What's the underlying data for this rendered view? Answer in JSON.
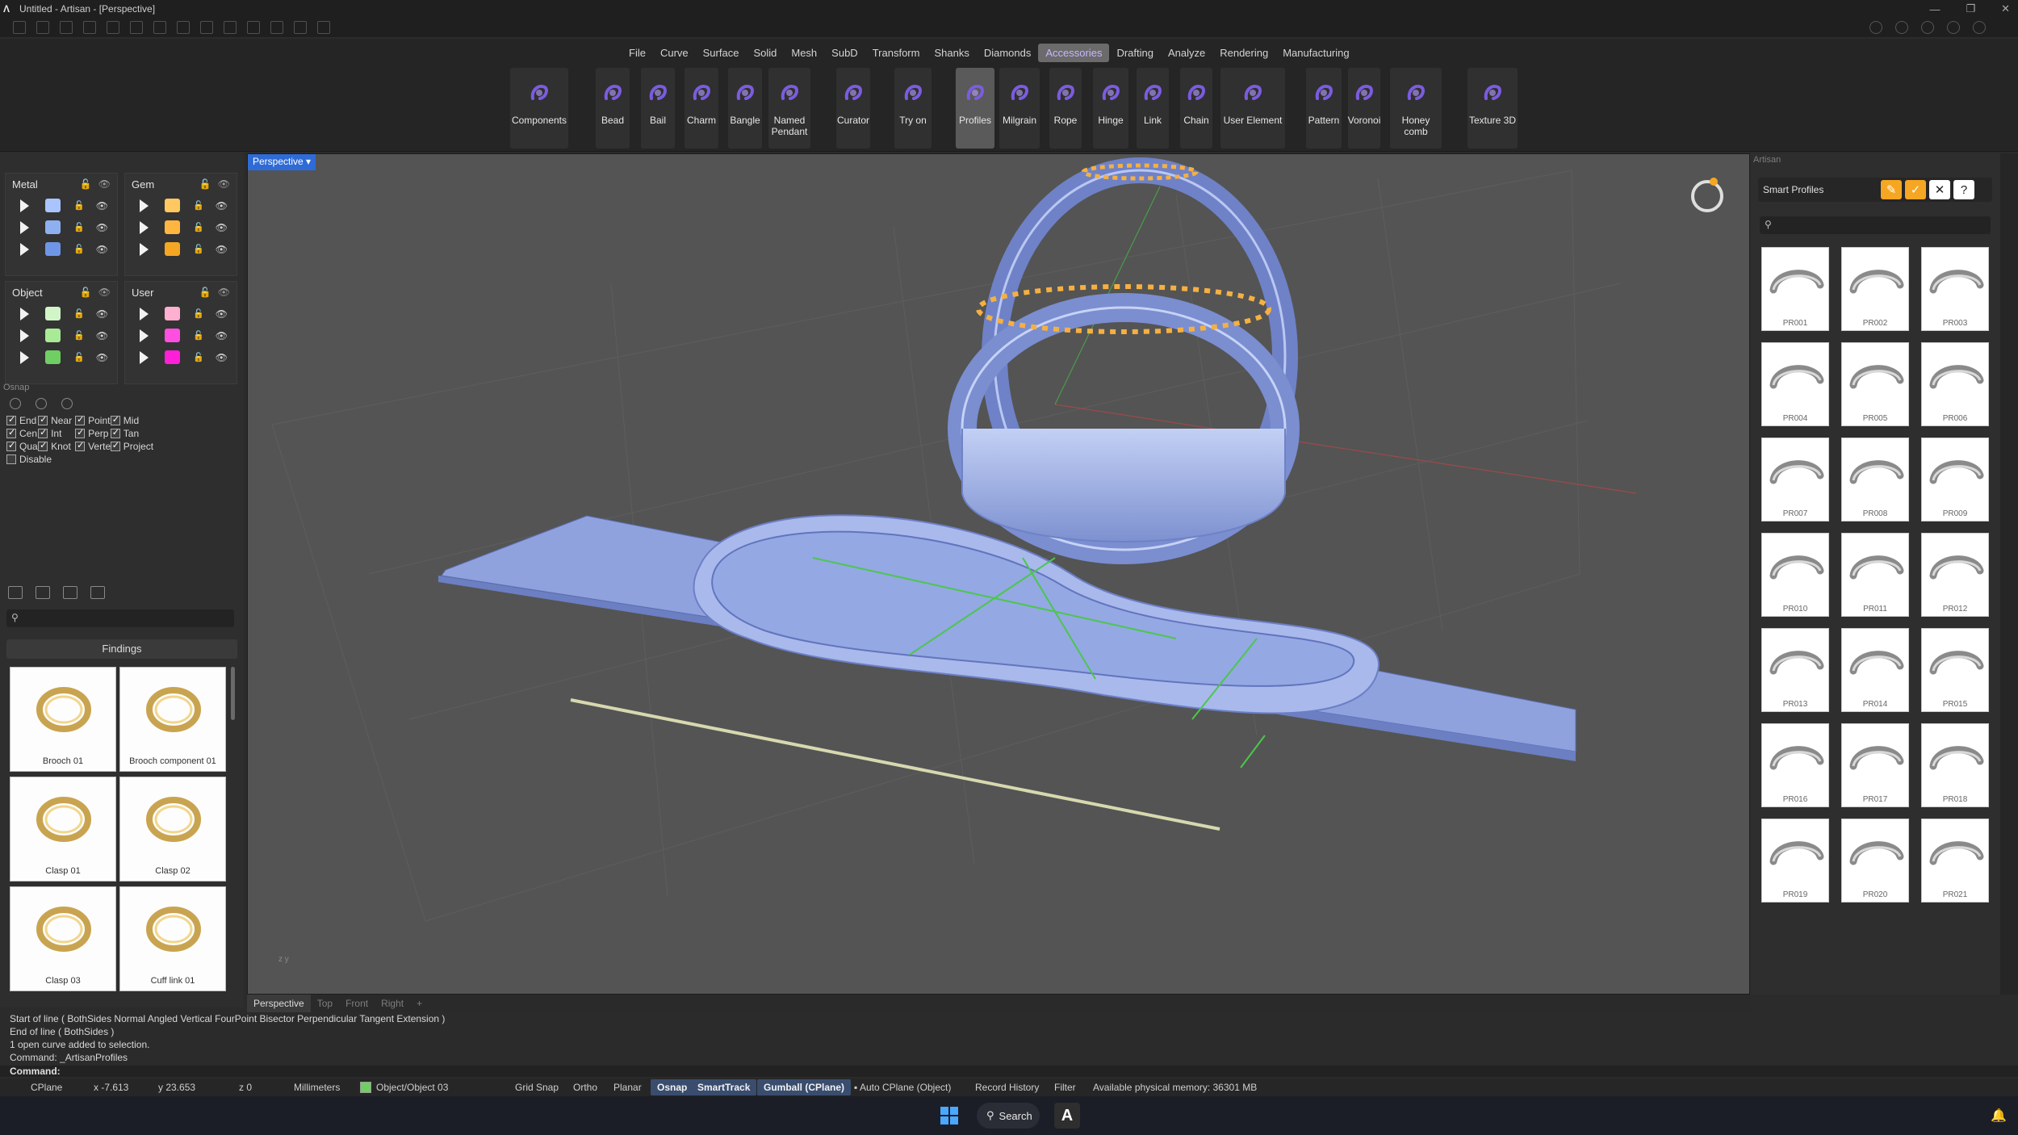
{
  "window": {
    "title": "Untitled - Artisan - [Perspective]",
    "controls": [
      "—",
      "❐",
      "✕"
    ]
  },
  "menu": {
    "items": [
      "File",
      "Curve",
      "Surface",
      "Solid",
      "Mesh",
      "SubD",
      "Transform",
      "Shanks",
      "Diamonds",
      "Accessories",
      "Drafting",
      "Analyze",
      "Rendering",
      "Manufacturing"
    ],
    "active": "Accessories"
  },
  "ribbon": {
    "buttons": [
      {
        "label": "Components",
        "icon": "components-icon"
      },
      {
        "label": "Bead",
        "icon": "bead-icon"
      },
      {
        "label": "Bail",
        "icon": "bail-icon"
      },
      {
        "label": "Charm",
        "icon": "charm-icon"
      },
      {
        "label": "Bangle",
        "icon": "bangle-icon"
      },
      {
        "label": "Named\nPendant",
        "icon": "named-pendant-icon"
      },
      {
        "label": "Curator",
        "icon": "curator-icon"
      },
      {
        "label": "Try on",
        "icon": "try-on-icon"
      },
      {
        "label": "Profiles",
        "icon": "profiles-icon"
      },
      {
        "label": "Milgrain",
        "icon": "milgrain-icon"
      },
      {
        "label": "Rope",
        "icon": "rope-icon"
      },
      {
        "label": "Hinge",
        "icon": "hinge-icon"
      },
      {
        "label": "Link",
        "icon": "link-icon"
      },
      {
        "label": "Chain",
        "icon": "chain-icon"
      },
      {
        "label": "User Element",
        "icon": "user-element-icon"
      },
      {
        "label": "Pattern",
        "icon": "pattern-icon"
      },
      {
        "label": "Voronoi",
        "icon": "voronoi-icon"
      },
      {
        "label": "Honey comb",
        "icon": "honeycomb-icon"
      },
      {
        "label": "Texture 3D",
        "icon": "texture-3d-icon"
      }
    ],
    "active": "Profiles",
    "accent": "#7b5ce0"
  },
  "layers": {
    "groups": [
      {
        "name": "Metal",
        "colors": [
          "#a9c4ff",
          "#8fb0f0",
          "#6f96e6"
        ]
      },
      {
        "name": "Gem",
        "colors": [
          "#ffc860",
          "#ffb640",
          "#f5a623"
        ]
      },
      {
        "name": "Object",
        "colors": [
          "#d2f5c8",
          "#a8ea96",
          "#6fcf62"
        ]
      },
      {
        "name": "User",
        "colors": [
          "#ffb0d0",
          "#ff4fe0",
          "#ff1fd8"
        ]
      }
    ]
  },
  "osnap": {
    "header": "Osnap",
    "items": [
      {
        "label": "End",
        "checked": true
      },
      {
        "label": "Near",
        "checked": true
      },
      {
        "label": "Point",
        "checked": true
      },
      {
        "label": "Mid",
        "checked": true
      },
      {
        "label": "Cen",
        "checked": true
      },
      {
        "label": "Int",
        "checked": true
      },
      {
        "label": "Perp",
        "checked": true
      },
      {
        "label": "Tan",
        "checked": true
      },
      {
        "label": "Quad",
        "checked": true
      },
      {
        "label": "Knot",
        "checked": true
      },
      {
        "label": "Vertex",
        "checked": true
      },
      {
        "label": "Project",
        "checked": true
      },
      {
        "label": "Disable",
        "checked": false
      }
    ]
  },
  "library": {
    "search_placeholder": "",
    "category": "Findings",
    "items": [
      "Brooch 01",
      "Brooch component 01",
      "Clasp 01",
      "Clasp 02",
      "Clasp 03",
      "Cuff link 01"
    ]
  },
  "viewport": {
    "label": "Perspective",
    "tabs": [
      "Perspective",
      "Top",
      "Front",
      "Right",
      "+"
    ],
    "active_tab": "Perspective"
  },
  "smart_profiles": {
    "panel_title": "Artisan",
    "title": "Smart Profiles",
    "items": [
      "PR001",
      "PR002",
      "PR003",
      "PR004",
      "PR005",
      "PR006",
      "PR007",
      "PR008",
      "PR009",
      "PR010",
      "PR011",
      "PR012",
      "PR013",
      "PR014",
      "PR015",
      "PR016",
      "PR017",
      "PR018",
      "PR019",
      "PR020",
      "PR021"
    ]
  },
  "command": {
    "history": [
      "Start of line ( BothSides  Normal  Angled  Vertical  FourPoint  Bisector  Perpendicular  Tangent  Extension )",
      "End of line ( BothSides )",
      "1 open curve added to selection.",
      "Command: _ArtisanProfiles"
    ],
    "prompt": "Command:"
  },
  "status": {
    "cplane": "CPlane",
    "x": "x -7.613",
    "y": "y 23.653",
    "z": "z 0",
    "units": "Millimeters",
    "layer": "Object/Object 03",
    "layer_color": "#6fcf62",
    "grid_snap": "Grid Snap",
    "ortho": "Ortho",
    "planar": "Planar",
    "osnap": "Osnap",
    "smarttrack": "SmartTrack",
    "gumball": "Gumball (CPlane)",
    "auto_cplane": "Auto CPlane (Object)",
    "record_history": "Record History",
    "filter": "Filter",
    "memory": "Available physical memory: 36301 MB"
  },
  "taskbar": {
    "search": "Search",
    "app_letter": "A"
  }
}
